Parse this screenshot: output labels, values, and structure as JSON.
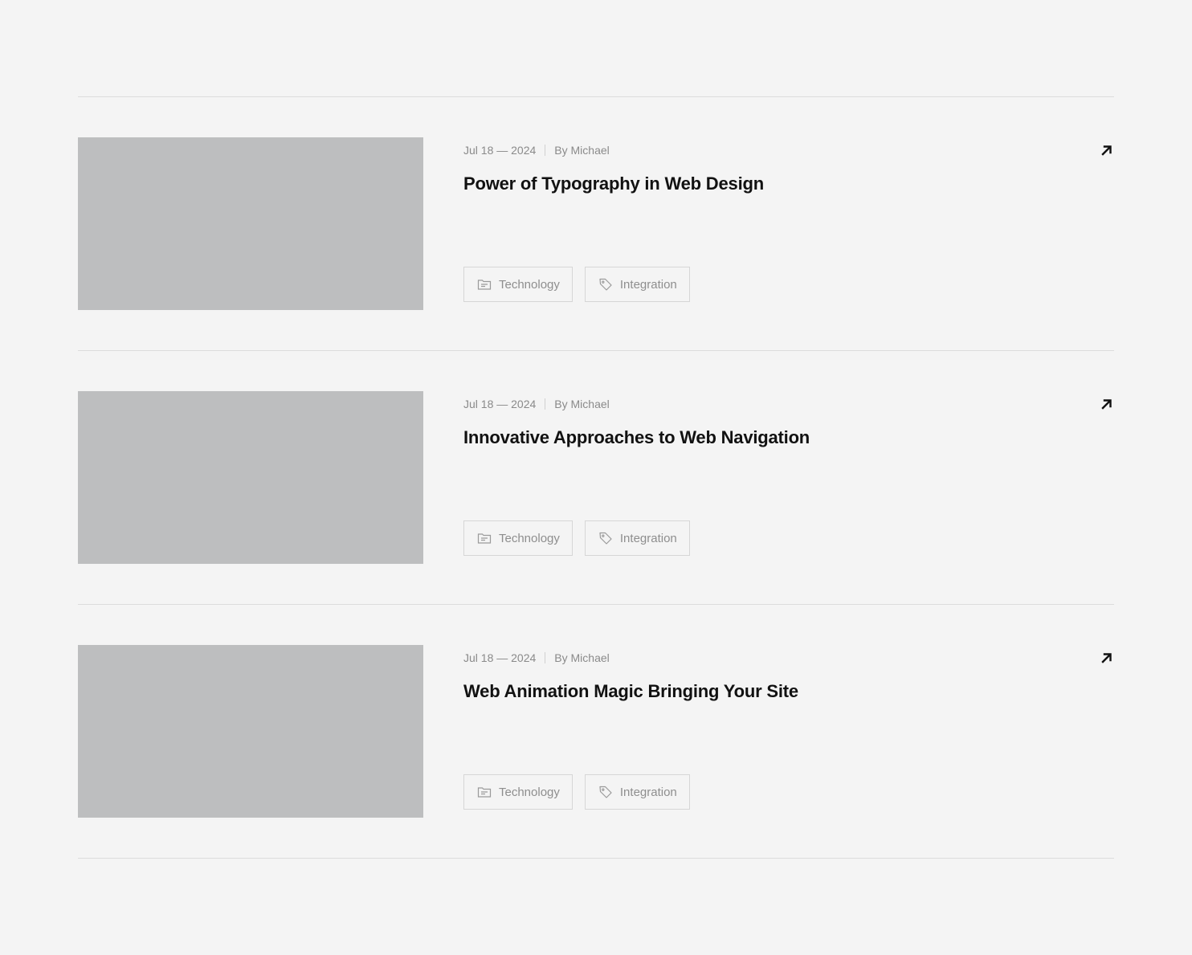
{
  "posts": [
    {
      "date": "Jul 18 — 2024",
      "author": "By Michael",
      "title": "Power of Typography in Web Design",
      "category": "Technology",
      "tag": "Integration"
    },
    {
      "date": "Jul 18 — 2024",
      "author": "By Michael",
      "title": "Innovative Approaches to Web Navigation",
      "category": "Technology",
      "tag": "Integration"
    },
    {
      "date": "Jul 18 — 2024",
      "author": "By Michael",
      "title": "Web Animation Magic Bringing Your Site",
      "category": "Technology",
      "tag": "Integration"
    }
  ],
  "icons": {
    "arrow": "arrow-up-right-icon",
    "category": "folder-icon",
    "tag": "tag-icon"
  },
  "colors": {
    "background": "#f4f4f4",
    "thumbnail": "#bdbebf",
    "title": "#111111",
    "muted": "#8a8a8a",
    "border": "#dcdcdc"
  }
}
